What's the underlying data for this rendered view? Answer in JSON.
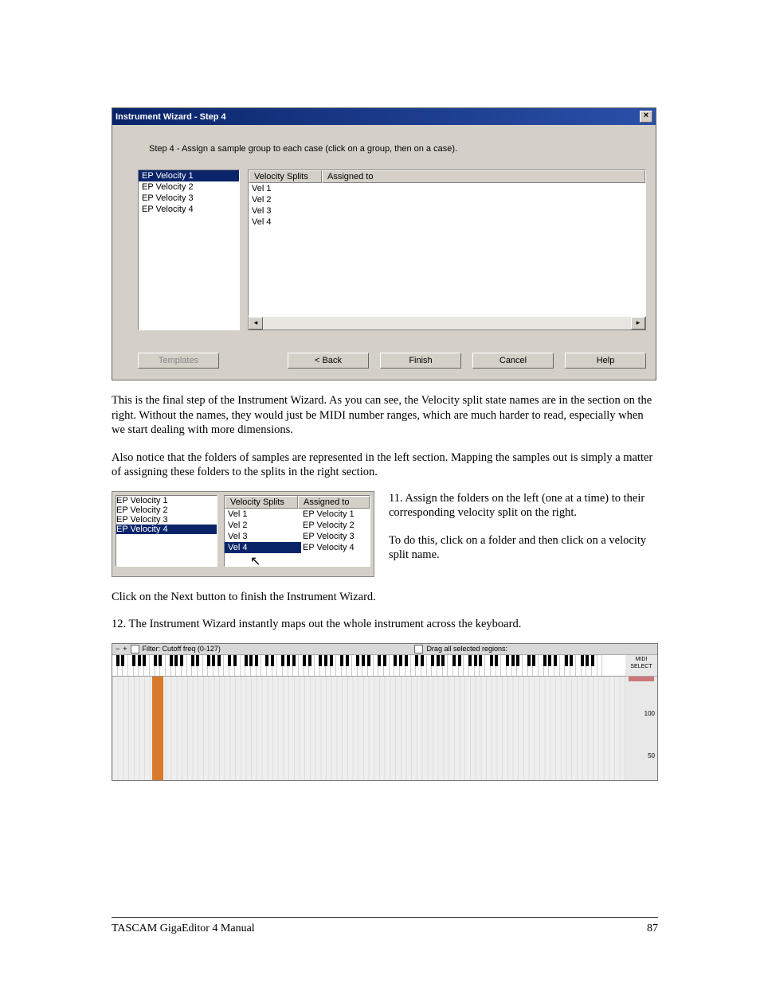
{
  "window": {
    "title": "Instrument Wizard - Step 4",
    "step_text": "Step 4 - Assign a sample group to each case (click on a group, then on a case).",
    "left_items": [
      "EP Velocity 1",
      "EP Velocity 2",
      "EP Velocity 3",
      "EP Velocity 4"
    ],
    "left_selected": 0,
    "cols": {
      "c1": "Velocity Splits",
      "c2": "Assigned to"
    },
    "rows": [
      {
        "split": "Vel 1",
        "assigned": ""
      },
      {
        "split": "Vel 2",
        "assigned": ""
      },
      {
        "split": "Vel 3",
        "assigned": ""
      },
      {
        "split": "Vel 4",
        "assigned": ""
      }
    ],
    "buttons": {
      "templates": "Templates",
      "back": "< Back",
      "finish": "Finish",
      "cancel": "Cancel",
      "help": "Help"
    }
  },
  "body": {
    "p1": "This is the final step of the Instrument Wizard.  As you can see, the Velocity split state names are in the section on the right.  Without the names, they would just be MIDI number ranges, which are much harder to read, especially when we start dealing with more dimensions.",
    "p2": "Also notice that the folders of samples are represented in the left section. Mapping the samples out is simply a matter of assigning these folders to the splits in the right section.",
    "step11a": "11. Assign the folders on the left (one at a time) to their corresponding velocity split on the right.",
    "step11b": "To do this, click on a folder and then click on a velocity split name.",
    "p3": "Click on the Next button to finish the Instrument Wizard.",
    "step12": "12.       The Instrument Wizard instantly maps out the whole instrument across the keyboard."
  },
  "mini": {
    "left_items": [
      "EP Velocity 1",
      "EP Velocity 2",
      "EP Velocity 3",
      "EP Velocity 4"
    ],
    "left_selected": 3,
    "cols": {
      "c1": "Velocity Splits",
      "c2": "Assigned to"
    },
    "rows": [
      {
        "split": "Vel 1",
        "assigned": "EP Velocity 1"
      },
      {
        "split": "Vel 2",
        "assigned": "EP Velocity 2"
      },
      {
        "split": "Vel 3",
        "assigned": "EP Velocity 3"
      },
      {
        "split": "Vel 4",
        "assigned": "EP Velocity 4"
      }
    ],
    "vel_selected": 3
  },
  "keyboard": {
    "minus": "−",
    "plus": "+",
    "filter_label": "Filter: Cutoff freq (0-127)",
    "drag_label": "Drag all selected regions:",
    "midi_select": "MIDI SELECT",
    "scale_100": "100",
    "scale_50": "50"
  },
  "footer": {
    "left": "TASCAM GigaEditor 4 Manual",
    "right": "87"
  }
}
